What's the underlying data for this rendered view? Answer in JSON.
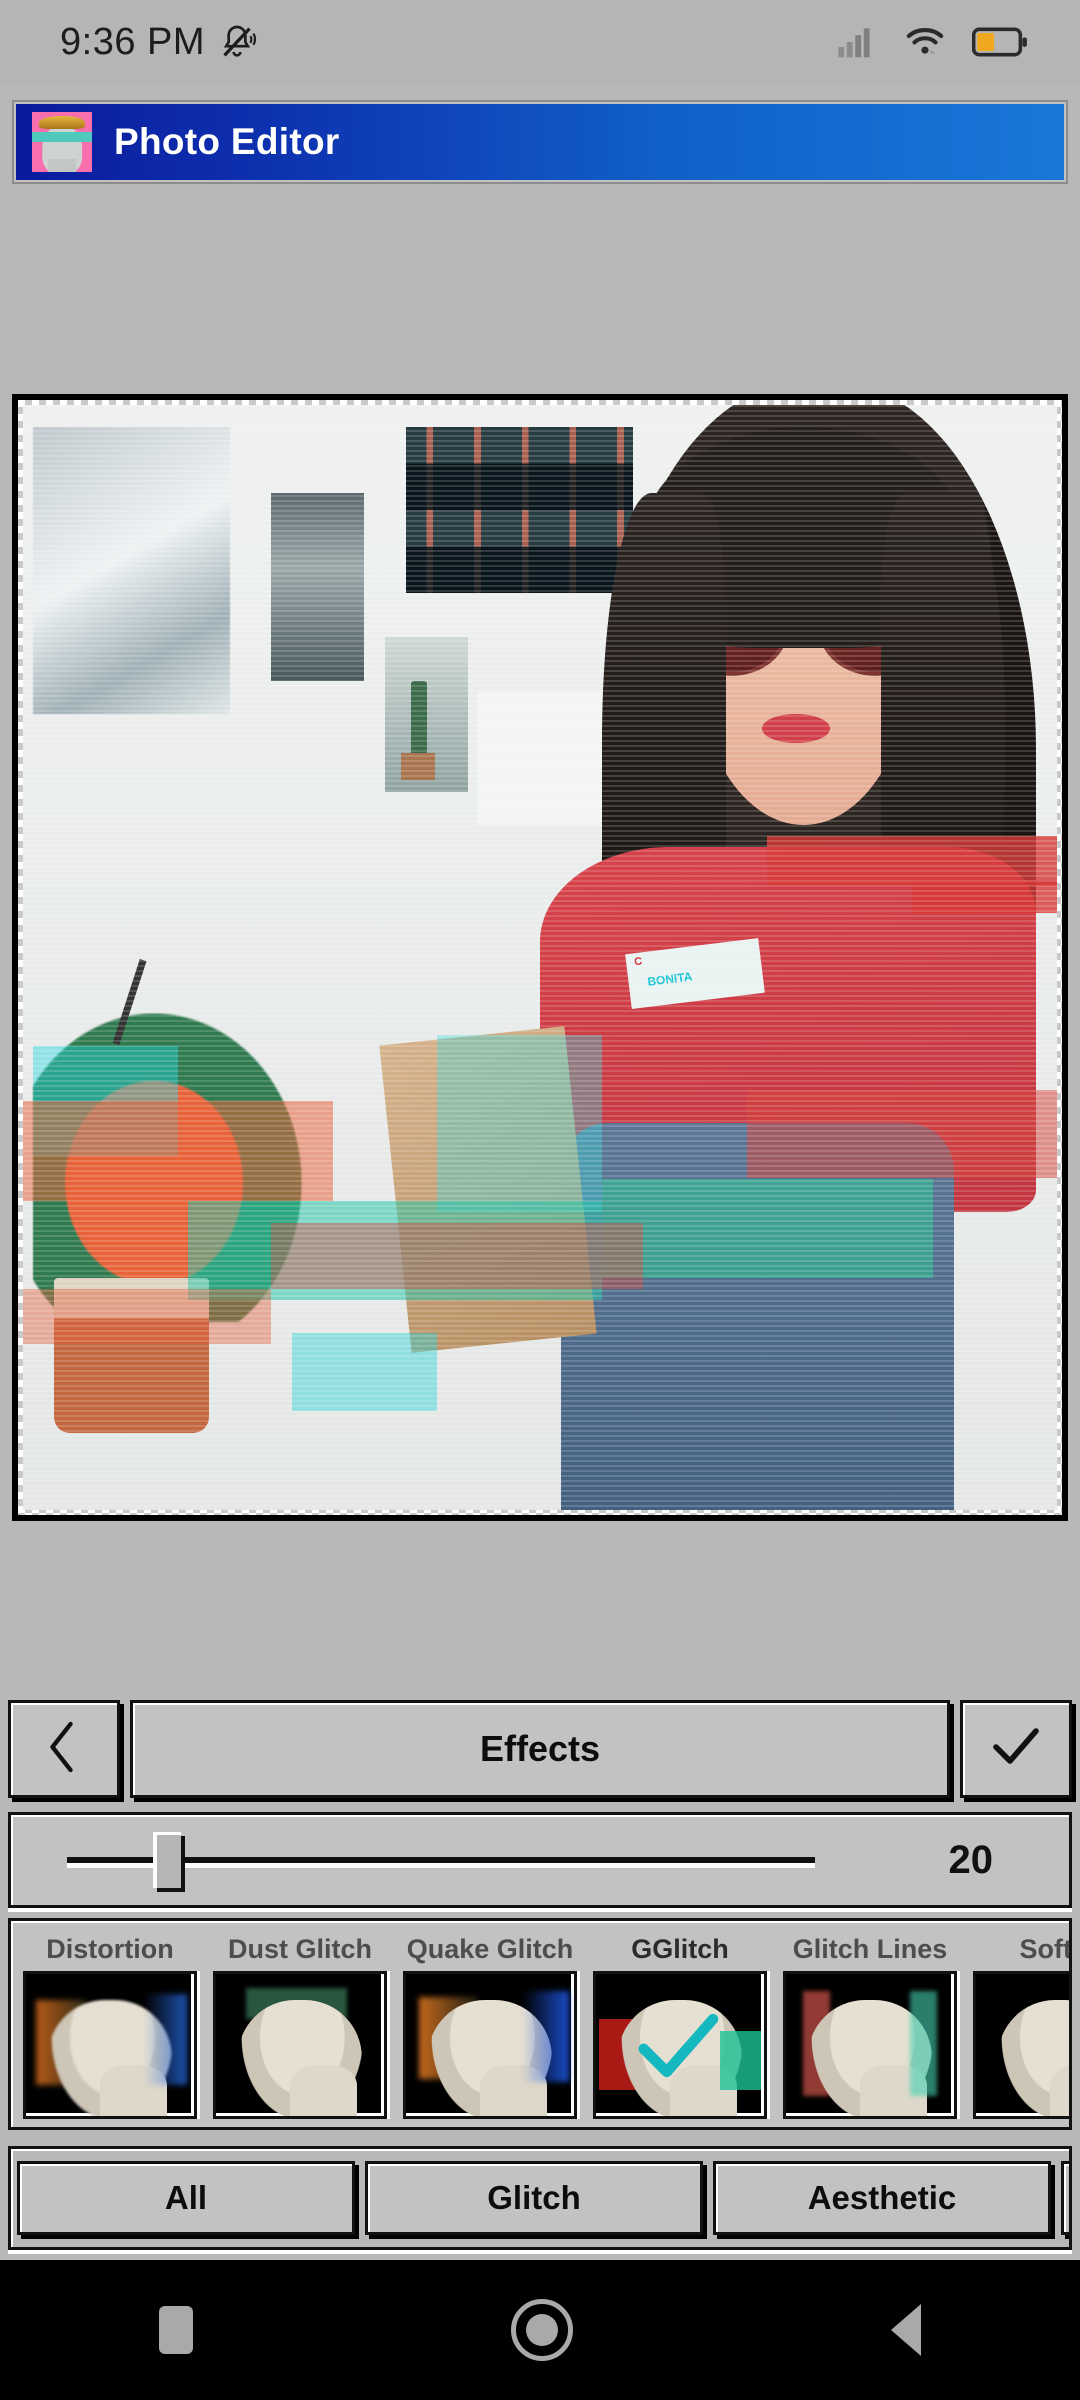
{
  "status_bar": {
    "time": "9:36 PM",
    "icons": [
      "bell-mute-icon",
      "signal-icon",
      "wifi-icon",
      "battery-icon"
    ],
    "battery_level_pct": 42,
    "signal_bars": 4
  },
  "app_header": {
    "title": "Photo Editor",
    "icon": "statue-app-icon",
    "gradient_start": "#0a1b9c",
    "gradient_end": "#1878d8"
  },
  "canvas": {
    "name": "photo-preview-canvas",
    "description": "Glitch-filtered photo of a woman in sunglasses and red t-shirt"
  },
  "toolbar": {
    "back_icon": "chevron-left-icon",
    "title": "Effects",
    "confirm_icon": "check-icon"
  },
  "slider": {
    "value": "20",
    "value_num": 20,
    "min": 0,
    "max": 100,
    "position_pct": 20
  },
  "effects": {
    "selected": "GGlitch",
    "selected_check_color": "#16b8c0",
    "items": [
      {
        "label": "Distortion",
        "selected": false
      },
      {
        "label": "Dust Glitch",
        "selected": false
      },
      {
        "label": "Quake Glitch",
        "selected": false
      },
      {
        "label": "GGlitch",
        "selected": true
      },
      {
        "label": "Glitch Lines",
        "selected": false
      },
      {
        "label": "Soft G",
        "selected": false
      }
    ]
  },
  "categories": {
    "active": "All",
    "items": [
      {
        "label": "All"
      },
      {
        "label": "Glitch"
      },
      {
        "label": "Aesthetic"
      }
    ]
  },
  "nav_bar": {
    "recents_icon": "square-icon",
    "home_icon": "circle-icon",
    "back_icon": "triangle-back-icon"
  },
  "colors": {
    "app_background": "#b8b8b8",
    "panel": "#c2c2c2",
    "accent_blue": "#1160c8",
    "battery_orange": "#f0a91e"
  }
}
